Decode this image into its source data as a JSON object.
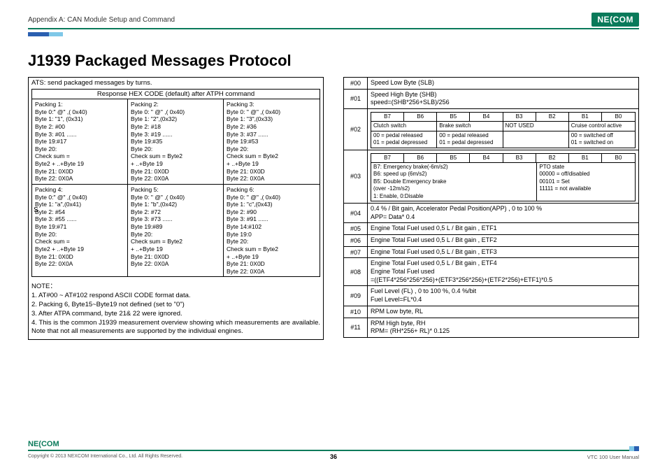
{
  "header": {
    "appendix": "Appendix A: CAN Module Setup and Command",
    "logo": "NE(COM"
  },
  "title": "J1939 Packaged Messages Protocol",
  "left": {
    "ats": "ATS: send packaged messages by turns.",
    "respHeader": "Response HEX CODE (default) after ATPH command",
    "s_label": "S",
    "packings": [
      "Packing 1:\nByte 0:\" @\" ,( 0x40)\nByte 1: \"1\", (0x31)\nByte 2: #00\nByte 3: #01 ......\nByte 19:#17\nByte 20:\nCheck sum =\nByte2 + ..+Byte 19\nByte 21: 0X0D\nByte 22: 0X0A",
      "Packing 2:\nByte 0: \" @\" ,( 0x40)\nByte 1: \"2\",(0x32)\nByte 2: #18\nByte 3: #19 ......\nByte 19:#35\nByte 20:\nCheck sum = Byte2\n+ ..+Byte 19\nByte 21: 0X0D\nByte 22: 0X0A",
      "Packing 3:\nByte 0: \" @\" ,( 0x40)\nByte 1: \"3\",(0x33)\nByte 2: #36\nByte 3: #37 ......\nByte 19:#53\nByte 20:\nCheck sum = Byte2\n+ ..+Byte 19\nByte 21: 0X0D\nByte 22: 0X0A",
      "Packing 4:\nByte 0:\" @\" ,( 0x40)\nByte 1: \"a\",(0x41)\nByte 2: #54\nByte 3: #55 ......\nByte 19:#71\nByte 20:\nCheck sum =\nByte2 + ..+Byte 19\nByte 21: 0X0D\nByte 22: 0X0A",
      "Packing 5:\nByte 0: \" @\" ,( 0x40)\nByte 1: \"b\",(0x42)\nByte 2: #72\nByte 3: #73 ......\nByte 19:#89\nByte 20:\nCheck sum = Byte2\n+ ..+Byte 19\nByte 21: 0X0D\nByte 22: 0X0A",
      "Packing 6:\nByte 0: \" @\" ,( 0x40)\nByte 1: \"c\",(0x43)\nByte 2: #90\nByte 3: #91 ......\nByte 14:#102\nByte 19:0\nByte 20:\nCheck sum = Byte2\n+ ..+Byte 19\nByte 21: 0X0D\nByte 22: 0X0A"
    ],
    "note": "NOTE：\n1. AT#00 ~ AT#102 respond ASCII CODE format data.\n2. Packing 6, Byte15~Byte19 not defined (set to \"0\")\n3. After ATPA command, byte 21& 22 were ignored.\n4. This is the common J1939 measurement overview showing which measurements are available. Note that not all measurements are supported by the individual engines."
  },
  "right": {
    "rows": [
      {
        "idx": "#00",
        "body": "Speed Low Byte (SLB)"
      },
      {
        "idx": "#01",
        "body": "Speed High Byte (SHB)\nspeed=(SHB*256+SLB)/256"
      }
    ],
    "row02": {
      "idx": "#02",
      "bits": [
        "B7",
        "B6",
        "B5",
        "B4",
        "B3",
        "B2",
        "B1",
        "B0"
      ],
      "labels": [
        "Clutch switch",
        "Brake switch",
        "NOT USED",
        "Cruise control active"
      ],
      "vals": [
        "00 = pedal released\n01 = pedal depressed",
        "00 = pedal released\n01 = pedal depressed",
        "",
        "00 = switched off\n01 = switched on"
      ]
    },
    "row03": {
      "idx": "#03",
      "bits": [
        "B7",
        "B6",
        "B5",
        "B4",
        "B3",
        "B2",
        "B1",
        "B0"
      ],
      "colL": "B7: Emergency brake(-6m/s2)\nB6: speed up (6m/s2)\nB5: Double Emergency brake\n(over -12m/s2)\n1: Enable, 0:Disable",
      "colR": "PTO state\n00000 = off/disabled\n00101 = Set\n11111 = not available"
    },
    "rows2": [
      {
        "idx": "#04",
        "body": "0.4 % / Bit gain, Accelerator Pedal Position(APP) , 0 to 100 %\nAPP= Data* 0.4"
      },
      {
        "idx": "#05",
        "body": "Engine Total Fuel used 0,5 L / Bit gain , ETF1"
      },
      {
        "idx": "#06",
        "body": "Engine Total Fuel used 0,5 L / Bit gain , ETF2"
      },
      {
        "idx": "#07",
        "body": "Engine Total Fuel used 0,5 L / Bit gain , ETF3"
      },
      {
        "idx": "#08",
        "body": "Engine Total Fuel used 0,5 L / Bit gain , ETF4\nEngine Total Fuel used\n=((ETF4*256*256*256)+(ETF3*256*256)+(ETF2*256)+ETF1)*0.5"
      },
      {
        "idx": "#09",
        "body": "Fuel Level (FL) , 0 to 100 %, 0.4 %/bit\nFuel Level=FL*0.4"
      },
      {
        "idx": "#10",
        "body": "RPM Low byte, RL"
      },
      {
        "idx": "#11",
        "body": "RPM High byte, RH\nRPM= (RH*256+ RL)* 0.125"
      }
    ]
  },
  "footer": {
    "logo": "NE(COM",
    "copyright": "Copyright © 2013 NEXCOM International Co., Ltd. All Rights Reserved.",
    "page": "36",
    "manual": "VTC 100 User Manual"
  }
}
